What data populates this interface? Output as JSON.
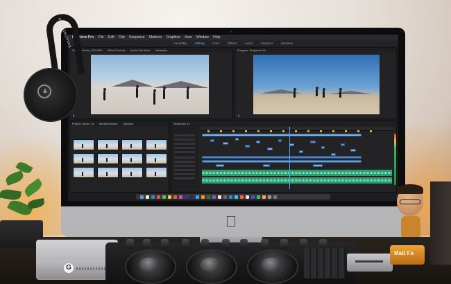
{
  "screen": {
    "menubar": {
      "app_name": "Premiere Pro",
      "items": [
        "File",
        "Edit",
        "Clip",
        "Sequence",
        "Markers",
        "Graphics",
        "View",
        "Window",
        "Help"
      ],
      "clock": ""
    },
    "workspaces": [
      "Assembly",
      "Editing",
      "Color",
      "Effects",
      "Audio",
      "Graphics",
      "Libraries"
    ],
    "active_workspace": "Editing",
    "source_tabs": [
      "Source: Music_001.MP4",
      "Effect Controls",
      "Audio Clip Mixer",
      "Metadata"
    ],
    "program_tabs": [
      "Program: Sequence 01"
    ],
    "project_tabs": [
      "Project: Music_01",
      "Media Browser",
      "Libraries"
    ],
    "timeline_tabs": [
      "Sequence 01"
    ]
  },
  "colors": {
    "accent": "#4fa0ff",
    "video_clip": "#7fb4e8",
    "audio_clip": "#2e9d72",
    "marker": "#e1a63a"
  },
  "props": {
    "headphones_brand": "audio-technica",
    "drive_logo": "G",
    "figurine_label": "Matt Fa"
  }
}
